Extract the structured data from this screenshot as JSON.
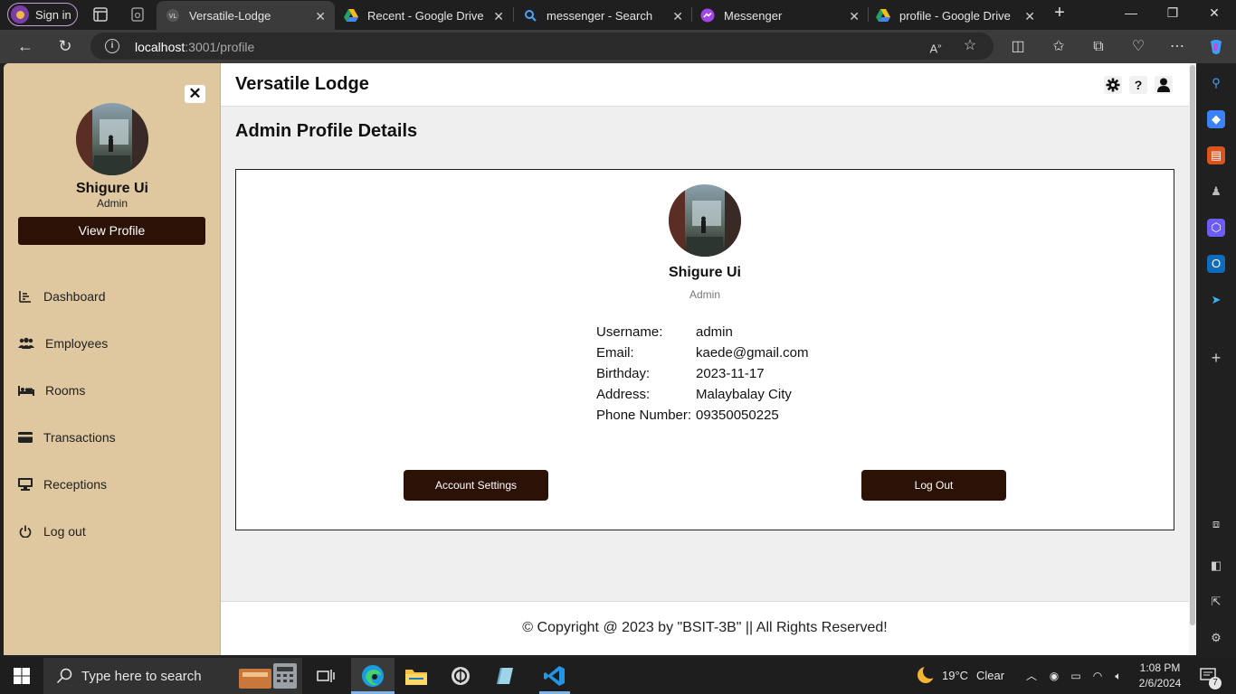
{
  "browser": {
    "signin_label": "Sign in",
    "tabs": [
      {
        "title": "Versatile-Lodge",
        "active": true
      },
      {
        "title": "Recent - Google Drive",
        "active": false
      },
      {
        "title": "messenger - Search",
        "active": false
      },
      {
        "title": "Messenger",
        "active": false
      },
      {
        "title": "profile - Google Drive",
        "active": false
      }
    ],
    "url_host": "localhost",
    "url_rest": ":3001/profile"
  },
  "sidebar": {
    "user_name": "Shigure Ui",
    "user_role": "Admin",
    "view_profile_label": "View Profile",
    "items": [
      {
        "label": "Dashboard",
        "icon": "chart-icon"
      },
      {
        "label": "Employees",
        "icon": "users-icon"
      },
      {
        "label": "Rooms",
        "icon": "bed-icon"
      },
      {
        "label": "Transactions",
        "icon": "card-icon"
      },
      {
        "label": "Receptions",
        "icon": "monitor-icon"
      },
      {
        "label": "Log out",
        "icon": "power-icon"
      }
    ]
  },
  "header": {
    "app_title": "Versatile Lodge",
    "help_symbol": "?"
  },
  "main": {
    "page_title": "Admin Profile Details",
    "profile": {
      "name": "Shigure Ui",
      "role": "Admin",
      "details": [
        {
          "label": "Username:",
          "value": "admin"
        },
        {
          "label": "Email:",
          "value": "kaede@gmail.com"
        },
        {
          "label": "Birthday:",
          "value": "2023-11-17"
        },
        {
          "label": "Address:",
          "value": "Malaybalay City"
        },
        {
          "label": "Phone Number:",
          "value": "09350050225"
        }
      ]
    },
    "account_settings_label": "Account Settings",
    "logout_label": "Log Out"
  },
  "footer": {
    "text": "© Copyright @ 2023 by \"BSIT-3B\" || All Rights Reserved!"
  },
  "taskbar": {
    "search_placeholder": "Type here to search",
    "weather_temp": "19°C",
    "weather_desc": "Clear",
    "time": "1:08 PM",
    "date": "2/6/2024",
    "notification_count": "7"
  },
  "colors": {
    "sidebar_bg": "#dfc79f",
    "button_bg": "#2b1106",
    "page_bg": "#efefef"
  }
}
